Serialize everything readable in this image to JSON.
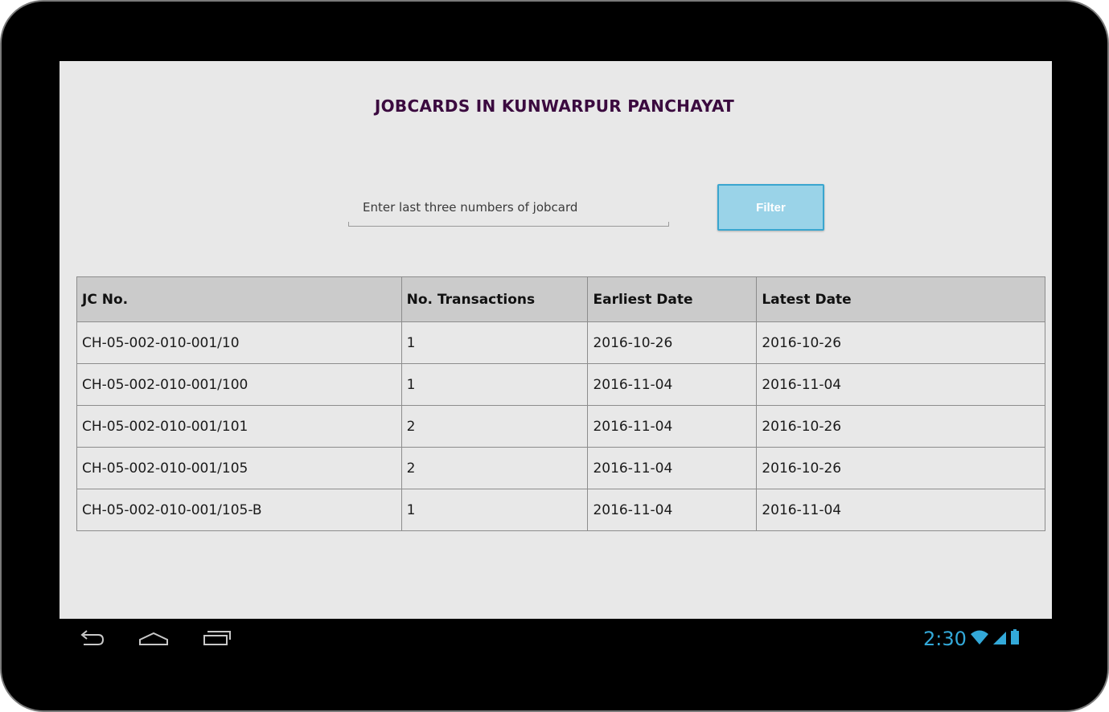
{
  "page": {
    "title": "JOBCARDS IN KUNWARPUR PANCHAYAT"
  },
  "search": {
    "placeholder": "Enter last three numbers of jobcard",
    "value": ""
  },
  "filter_button": {
    "label": "Filter"
  },
  "table": {
    "headers": [
      "JC No.",
      "No. Transactions",
      "Earliest Date",
      "Latest Date"
    ],
    "rows": [
      [
        "CH-05-002-010-001/10",
        "1",
        "2016-10-26",
        "2016-10-26"
      ],
      [
        "CH-05-002-010-001/100",
        "1",
        "2016-11-04",
        "2016-11-04"
      ],
      [
        "CH-05-002-010-001/101",
        "2",
        "2016-11-04",
        "2016-10-26"
      ],
      [
        "CH-05-002-010-001/105",
        "2",
        "2016-11-04",
        "2016-10-26"
      ],
      [
        "CH-05-002-010-001/105-B",
        "1",
        "2016-11-04",
        "2016-11-04"
      ]
    ]
  },
  "status_bar": {
    "time": "2:30",
    "icons": [
      "wifi-icon",
      "signal-icon",
      "battery-icon"
    ],
    "accent_color": "#33a9d9"
  },
  "nav_bar": {
    "icons": [
      "back-icon",
      "home-icon",
      "recent-apps-icon"
    ]
  },
  "colors": {
    "title": "#3b0a3f",
    "button_bg": "#9ad3e8",
    "button_border": "#3aa6cf",
    "header_bg": "#cbcbcb",
    "screen_bg": "#e8e8e8"
  }
}
